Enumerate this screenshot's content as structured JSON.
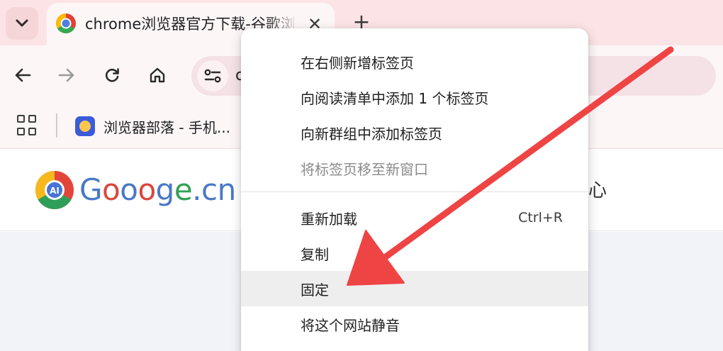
{
  "tabstrip": {
    "active_tab": {
      "title": "chrome浏览器官方下载-谷歌浏览器",
      "close_glyph": "✕"
    },
    "new_tab_glyph": "+"
  },
  "toolbar": {
    "icons": [
      "back-arrow-icon",
      "forward-arrow-icon",
      "reload-icon",
      "home-icon",
      "site-info-icon"
    ],
    "url_fragment": "c"
  },
  "bookmarks": {
    "apps_icon": "apps-grid-icon",
    "items": [
      {
        "label": "浏览器部落 - 手机..."
      }
    ]
  },
  "page": {
    "logo": {
      "part1": "G",
      "part2": "o",
      "part3": "o",
      "part4": "o",
      "part5": "g",
      "part6": "e",
      "part7": ".cn"
    },
    "nav_fragment": "心"
  },
  "context_menu": {
    "items": [
      {
        "label": "在右侧新增标签页",
        "shortcut": "",
        "disabled": false
      },
      {
        "label": "向阅读清单中添加 1 个标签页",
        "shortcut": "",
        "disabled": false
      },
      {
        "label": "向新群组中添加标签页",
        "shortcut": "",
        "disabled": false
      },
      {
        "label": "将标签页移至新窗口",
        "shortcut": "",
        "disabled": true
      },
      {
        "label": "重新加载",
        "shortcut": "Ctrl+R",
        "disabled": false
      },
      {
        "label": "复制",
        "shortcut": "",
        "disabled": false
      },
      {
        "label": "固定",
        "shortcut": "",
        "disabled": false,
        "highlighted": true
      },
      {
        "label": "将这个网站静音",
        "shortcut": "",
        "disabled": false
      }
    ]
  },
  "colors": {
    "tabstrip_bg": "#fce4e6",
    "toolbar_bg": "#fdf6f7",
    "annotation_arrow": "#ef4444"
  }
}
